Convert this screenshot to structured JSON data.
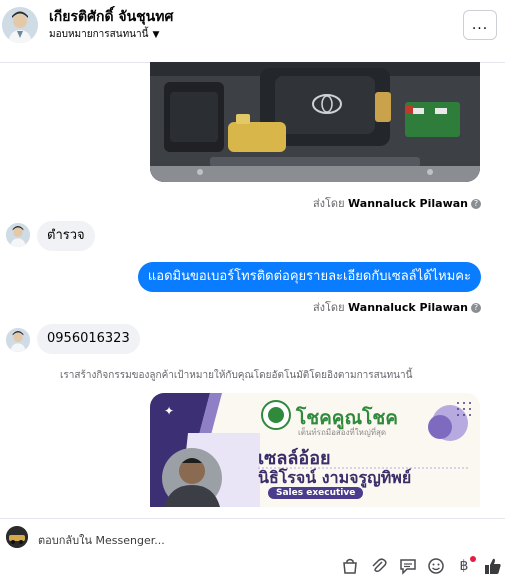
{
  "header": {
    "name": "เกียรติศักดิ์ จันชุนทศ",
    "subtitle": "มอบหมายการสนทนานี้",
    "more_label": "..."
  },
  "messages": {
    "sent_by_1": {
      "prefix": "ส่งโดย",
      "agent": "Wannaluck Pilawan"
    },
    "incoming_1": "ตำรวจ",
    "outgoing_1": "แอดมินขอเบอร์โทรติดต่อคุยรายละเอียดกับเซลล์ได้ไหมคะ",
    "sent_by_2": {
      "prefix": "ส่งโดย",
      "agent": "Wannaluck Pilawan"
    },
    "incoming_2": "0956016323",
    "system_note": "เราสร้างกิจกรรมของลูกค้าเป้าหมายให้กับคุณโดยอัตโนมัติโดยอิงตามการสนทนานี้"
  },
  "card": {
    "brand": "โชคคูณโชค",
    "tagline": "เต็นท์รถมือสองที่ใหญ่ที่สุด",
    "title": "เซลล์อ้อย",
    "person": "นิธิโรจน์  งามจรูญทิพย์",
    "role": "Sales executive"
  },
  "composer": {
    "placeholder": "ตอบกลับใน Messenger...",
    "currency_symbol": "฿"
  },
  "icons": [
    "more-icon",
    "chevron-down-icon",
    "info-icon",
    "bag-icon",
    "paperclip-icon",
    "chat-icon",
    "emoji-icon",
    "baht-icon",
    "thumbs-up-icon"
  ],
  "colors": {
    "outgoing_bubble": "#0a7cff",
    "incoming_bubble": "#f0f2f5",
    "notification_dot": "#e41e3f"
  }
}
